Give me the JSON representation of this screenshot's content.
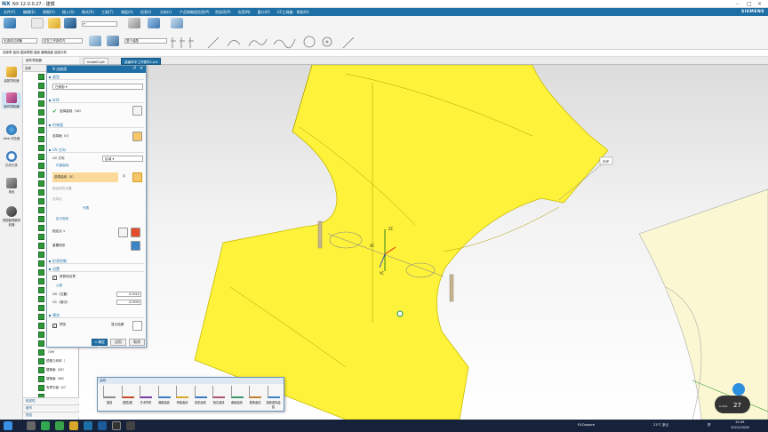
{
  "app": {
    "logo": "NX",
    "title": "NX 12.0.0.27 - 建模",
    "brand": "SIEMENS"
  },
  "menubar": {
    "items": [
      "文件(F)",
      "编辑(E)",
      "视图(V)",
      "插入(S)",
      "格式(R)",
      "工具(T)",
      "装配(A)",
      "信息(I)",
      "分析(L)",
      "产品和制造信息(P)",
      "首选项(P)",
      "应用(N)",
      "窗口(O)",
      "GC工具箱",
      "帮助(H)"
    ]
  },
  "ribbon": {
    "select1": "整个装配",
    "select2": "仅在工作部件内",
    "select3": "无选择过滤器"
  },
  "breadcrumb": {
    "text": "选择条  曲线  直接草图  曲面  编辑曲面  曲线分析"
  },
  "tabs": [
    {
      "label": "model2.prt"
    },
    {
      "label": "曲面体中工作部件1.prt"
    }
  ],
  "left_icons": [
    {
      "label": "装配导航器",
      "icon": "assembly-navigator-icon"
    },
    {
      "label": "部件导航器",
      "icon": "part-navigator-icon"
    },
    {
      "label": "Web 浏览器",
      "icon": "web-browser-icon"
    },
    {
      "label": "历史记录",
      "icon": "history-icon"
    },
    {
      "label": "角色",
      "icon": "roles-icon"
    },
    {
      "label": "视图管理器导航器",
      "icon": "view-manager-icon"
    }
  ],
  "navigator": {
    "header": "部件导航器",
    "column": "名称",
    "rows": [
      "（49）",
      "镜像几何体（",
      "替换面（45）",
      "替换面（46）",
      "有界平面（47"
    ],
    "footer": [
      "相关性",
      "细节",
      "预览"
    ]
  },
  "dialog": {
    "title": "N 边曲面",
    "sec_type": "类型",
    "type_value": "已修剪",
    "sec_outer": "外环",
    "outer_value": "选择曲线（16）",
    "sec_constraint": "约束面",
    "constraint_value": "选择面（0）",
    "sec_uv": "UV 方向",
    "uv_label": "UV 方向",
    "uv_value": "区域",
    "inner_label": "内部曲线",
    "inner_value": "选择曲线（0）",
    "spec_new": "指定新的位置",
    "spec_point": "选择点",
    "list_label": "列表",
    "def_rect": "定义矩形",
    "point1": "指定点 1",
    "reset_rect": "重置矩形",
    "sec_shape": "形状控制",
    "sec_settings": "设置",
    "modify_boundary": "修剪到边界",
    "tolerance_label": "公差",
    "g0_label": "G0（位置）",
    "g0_value": "0.0010",
    "g1_label": "G1（相切）",
    "g1_value": "0.0500",
    "sec_preview": "预览",
    "preview_check": "预览",
    "show_result": "显示结果",
    "ok": "< 确定 >",
    "apply": "应用",
    "cancel": "取消"
  },
  "viewport": {
    "tag1": "外环",
    "marker": "XC",
    "axis_y": "YC",
    "axis_z": "ZC",
    "count": "27",
    "hud": "0.1K/s"
  },
  "toolbox": {
    "title": "曲线",
    "tools": [
      "直线",
      "圆弧/圆",
      "艺术样条",
      "偏置曲线",
      "桥接曲线",
      "投影曲线",
      "相交曲线",
      "截面曲线",
      "替换曲线",
      "抽取虚拟曲线"
    ]
  },
  "taskbar": {
    "app": "EVCapture",
    "weather": "21°C 多云",
    "time": "15:49",
    "date": "2021/10/26",
    "ime": "拼"
  },
  "colors": {
    "accent": "#1d6fa5",
    "surface": "#fff23a",
    "check": "#2f9a3a"
  }
}
